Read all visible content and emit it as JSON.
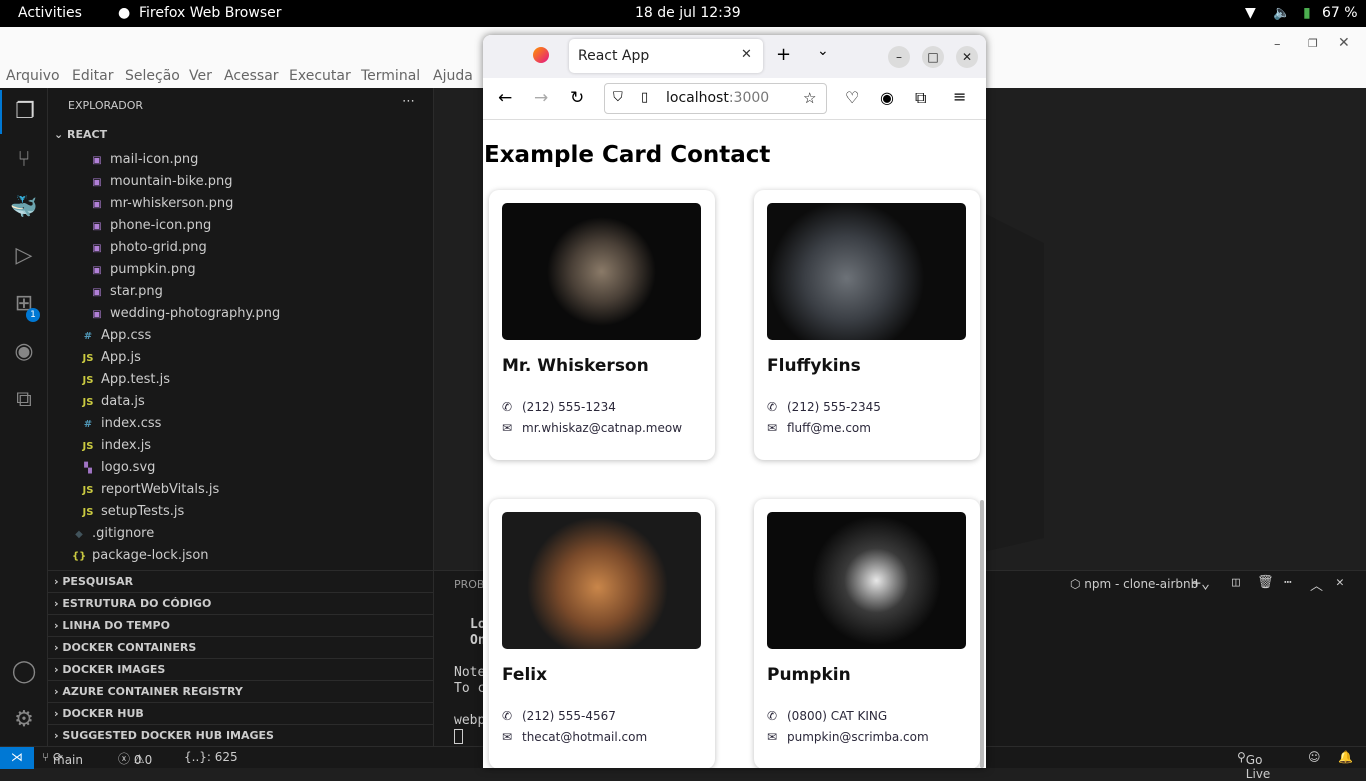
{
  "topbar": {
    "activities": "Activities",
    "app": "Firefox Web Browser",
    "datetime": "18 de jul  12:39",
    "battery": "67 %"
  },
  "vscode": {
    "menu": [
      "Arquivo",
      "Editar",
      "Seleção",
      "Ver",
      "Acessar",
      "Executar",
      "Terminal",
      "Ajuda"
    ],
    "explorer_title": "EXPLORADOR",
    "root": "REACT",
    "files": [
      {
        "name": "mail-icon.png",
        "type": "img",
        "indent": 2
      },
      {
        "name": "mountain-bike.png",
        "type": "img",
        "indent": 2
      },
      {
        "name": "mr-whiskerson.png",
        "type": "img",
        "indent": 2
      },
      {
        "name": "phone-icon.png",
        "type": "img",
        "indent": 2
      },
      {
        "name": "photo-grid.png",
        "type": "img",
        "indent": 2
      },
      {
        "name": "pumpkin.png",
        "type": "img",
        "indent": 2
      },
      {
        "name": "star.png",
        "type": "img",
        "indent": 2
      },
      {
        "name": "wedding-photography.png",
        "type": "img",
        "indent": 2
      },
      {
        "name": "App.css",
        "type": "css",
        "indent": 1
      },
      {
        "name": "App.js",
        "type": "js",
        "indent": 1
      },
      {
        "name": "App.test.js",
        "type": "js",
        "indent": 1
      },
      {
        "name": "data.js",
        "type": "js",
        "indent": 1
      },
      {
        "name": "index.css",
        "type": "css",
        "indent": 1
      },
      {
        "name": "index.js",
        "type": "js",
        "indent": 1
      },
      {
        "name": "logo.svg",
        "type": "svg",
        "indent": 1
      },
      {
        "name": "reportWebVitals.js",
        "type": "js",
        "indent": 1
      },
      {
        "name": "setupTests.js",
        "type": "js",
        "indent": 1
      },
      {
        "name": ".gitignore",
        "type": "git",
        "indent": 0
      },
      {
        "name": "package-lock.json",
        "type": "json",
        "indent": 0
      }
    ],
    "sections": [
      "PESQUISAR",
      "ESTRUTURA DO CÓDIGO",
      "LINHA DO TEMPO",
      "DOCKER CONTAINERS",
      "DOCKER IMAGES",
      "AZURE CONTAINER REGISTRY",
      "DOCKER HUB",
      "SUGGESTED DOCKER HUB IMAGES"
    ],
    "extensions_badge": "1",
    "panel": {
      "tab": "PROBL",
      "terminal_name": "npm - clone-airbnb",
      "lines": [
        "Lo",
        "On",
        "Note",
        "To c",
        "webp"
      ]
    },
    "status": {
      "branch": "main",
      "errors": "0",
      "warnings": "0",
      "json": "{..}: 625",
      "golive": "Go Live"
    }
  },
  "firefox": {
    "tab_title": "React App",
    "url_host": "localhost",
    "url_port": ":3000"
  },
  "page": {
    "heading": "Example Card Contact",
    "contacts": [
      {
        "name": "Mr. Whiskerson",
        "phone": "(212) 555-1234",
        "email": "mr.whiskaz@catnap.meow"
      },
      {
        "name": "Fluffykins",
        "phone": "(212) 555-2345",
        "email": "fluff@me.com"
      },
      {
        "name": "Felix",
        "phone": "(212) 555-4567",
        "email": "thecat@hotmail.com"
      },
      {
        "name": "Pumpkin",
        "phone": "(0800) CAT KING",
        "email": "pumpkin@scrimba.com"
      }
    ]
  },
  "colors": {
    "accent": "#0078d4",
    "vscode_bg": "#181818"
  }
}
